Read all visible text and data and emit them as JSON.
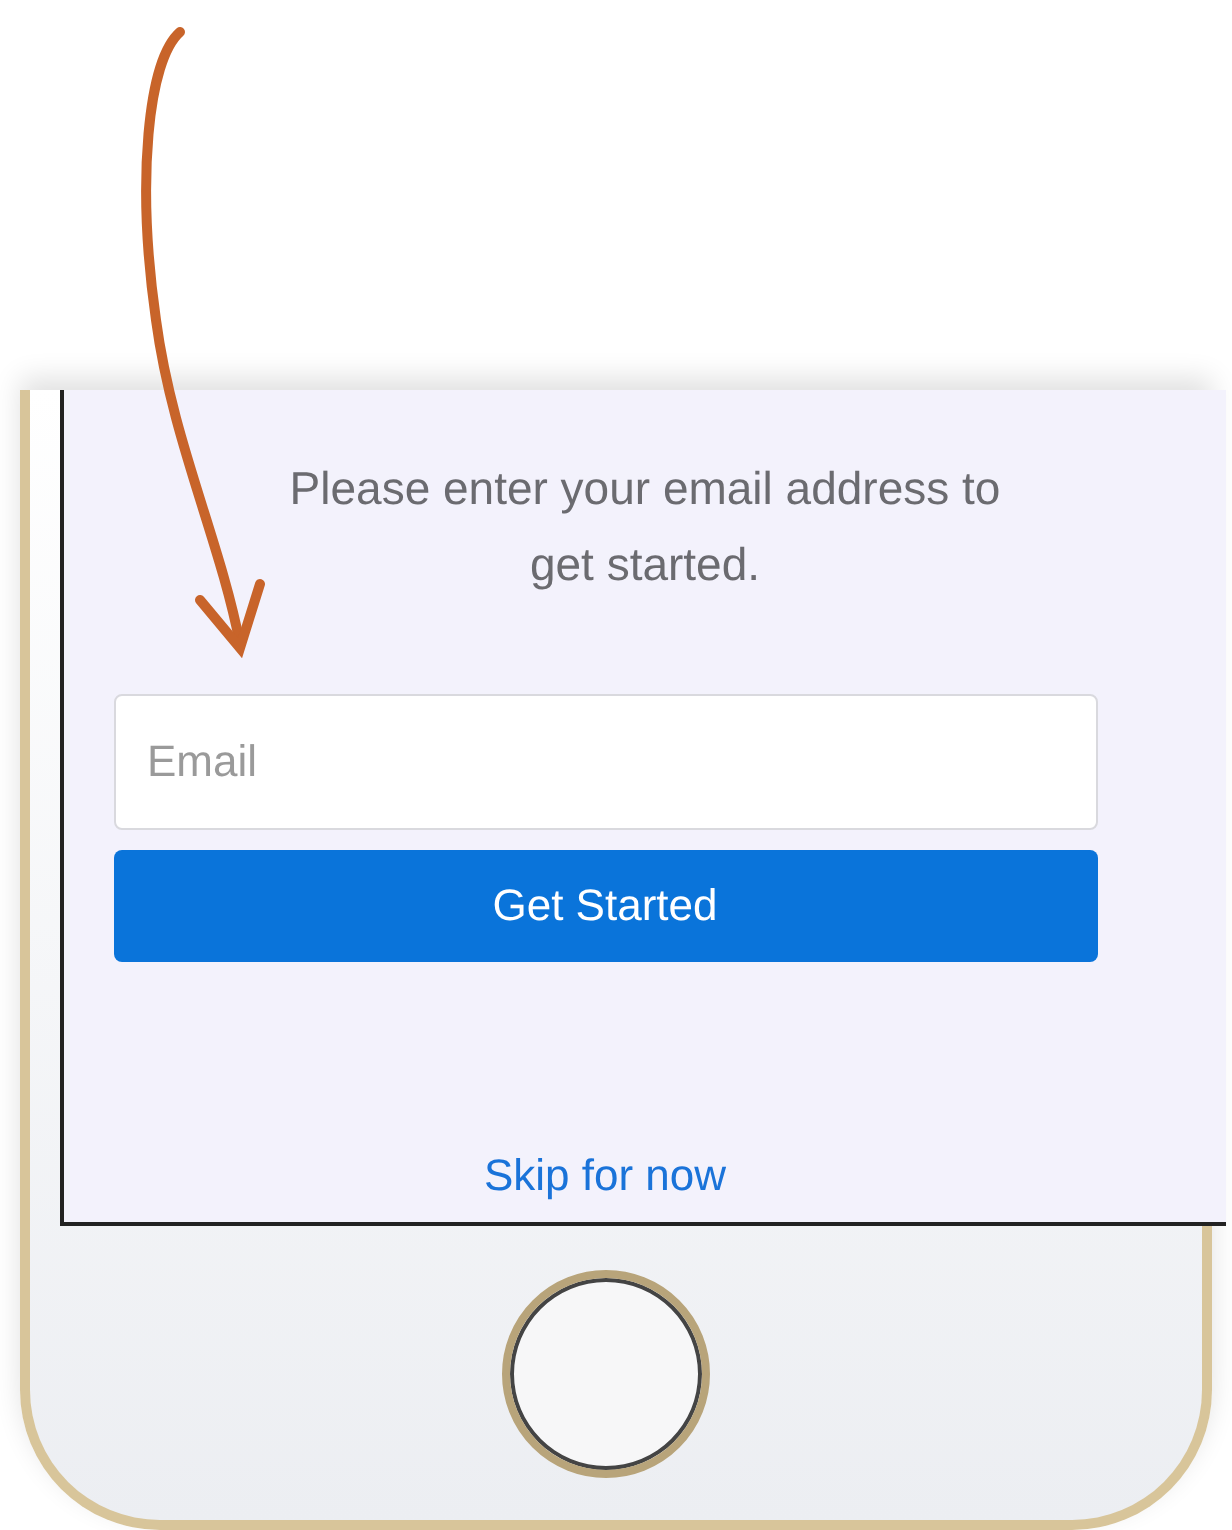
{
  "screen": {
    "instructions": "Please enter your email address to get started.",
    "email_field": {
      "placeholder": "Email"
    },
    "submit_button": {
      "label": "Get Started"
    },
    "skip_link": {
      "label": "Skip for now"
    }
  }
}
